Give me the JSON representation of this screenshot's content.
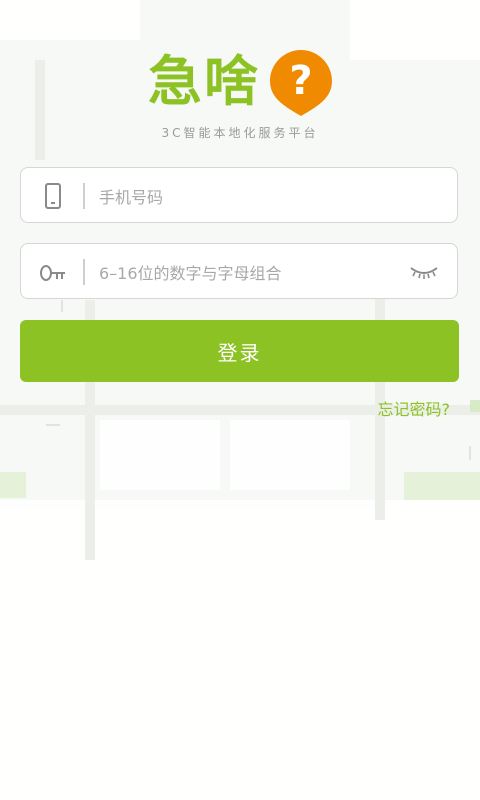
{
  "brand": {
    "name": "急啥",
    "badge_glyph": "?",
    "slogan": "3C智能本地化服务平台",
    "badge_color": "#f08a00",
    "brand_color": "#8cc224"
  },
  "form": {
    "phone": {
      "placeholder": "手机号码",
      "value": "",
      "icon": "phone-icon"
    },
    "password": {
      "placeholder": "6–16位的数字与字母组合",
      "value": "",
      "icon": "key-icon",
      "toggle_icon": "eye-closed-icon"
    },
    "login_label": "登录",
    "forgot_label": "忘记密码?"
  }
}
